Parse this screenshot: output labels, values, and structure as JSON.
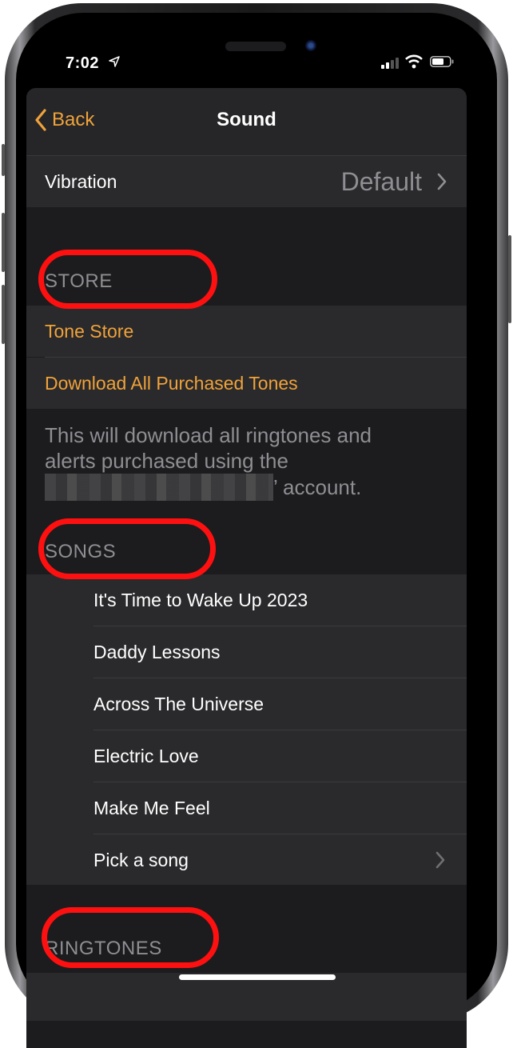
{
  "status_bar": {
    "time": "7:02",
    "icons": [
      "location-arrow-icon",
      "cellular-signal-icon",
      "wifi-icon",
      "battery-icon"
    ]
  },
  "navbar": {
    "back_label": "Back",
    "title": "Sound"
  },
  "vibration": {
    "label": "Vibration",
    "value": "Default"
  },
  "store": {
    "header": "STORE",
    "items": [
      {
        "label": "Tone Store"
      },
      {
        "label": "Download All Purchased Tones"
      }
    ],
    "footer_line1": "This will download all ringtones and",
    "footer_line2": "alerts purchased using the",
    "footer_line3_suffix": "’ account."
  },
  "songs": {
    "header": "SONGS",
    "items": [
      {
        "label": "It's Time to Wake Up 2023"
      },
      {
        "label": "Daddy Lessons"
      },
      {
        "label": "Across The Universe"
      },
      {
        "label": "Electric Love"
      },
      {
        "label": "Make Me Feel"
      },
      {
        "label": "Pick a song"
      }
    ]
  },
  "ringtones": {
    "header": "RINGTONES"
  },
  "colors": {
    "accent": "#f0a23a",
    "annotation": "#ff1010",
    "background": "#1c1c1e",
    "cell": "#2a2a2c",
    "secondary_text": "#8e8e93"
  }
}
